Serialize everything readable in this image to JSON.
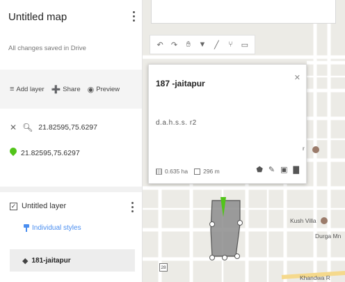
{
  "sidebar": {
    "map_title": "Untitled map",
    "save_status": "All changes saved in Drive",
    "actions": {
      "add_layer": "Add layer",
      "share": "Share",
      "preview": "Preview"
    },
    "search_query": "21.82595,75.6297",
    "pin_label": "21.82595,75.6297",
    "layer": {
      "name": "Untitled layer",
      "styles_label": "Individual styles",
      "feature_name": "181-jaitapur"
    }
  },
  "map": {
    "popup": {
      "title": "187  -jaitapur",
      "description": "d.a.h.s.s. r2",
      "area": "0.635 ha",
      "perimeter": "296 m"
    },
    "labels": {
      "kush_villa": "Kush Villa",
      "durga": "Durga Mn",
      "road_partial": "Khandwa R",
      "poi_partial": "r",
      "route_number": "28"
    }
  },
  "colors": {
    "accent": "#4a8ef0",
    "pin": "#52c41a",
    "polygon_fill": "#8c8c8c",
    "map_bg": "#ecebe6"
  },
  "icons": [
    "add-layer-icon",
    "share-icon",
    "preview-icon",
    "close-icon",
    "search-icon",
    "pin-icon",
    "checkbox-icon",
    "paint-icon",
    "polygon-icon",
    "undo-icon",
    "redo-icon",
    "hand-icon",
    "marker-icon",
    "line-icon",
    "route-icon",
    "ruler-icon",
    "style-icon",
    "edit-icon",
    "camera-icon",
    "trash-icon"
  ]
}
